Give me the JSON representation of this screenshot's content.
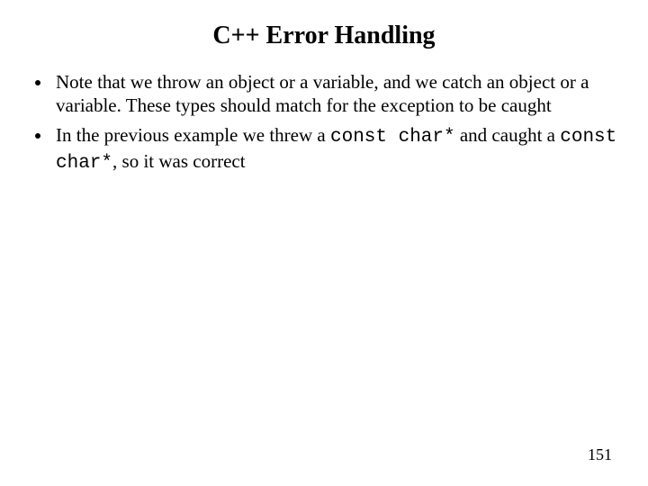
{
  "slide": {
    "title": "C++ Error Handling",
    "bullets": [
      {
        "pre1": "Note that we throw an object or a variable, and we catch an object or a variable. These types should match for the exception to be caught"
      },
      {
        "pre1": "In the previous example we threw a ",
        "code1": "const char*",
        "mid1": " and caught a ",
        "code2": "const char*",
        "post1": ", so it was correct"
      }
    ],
    "page_number": "151"
  }
}
